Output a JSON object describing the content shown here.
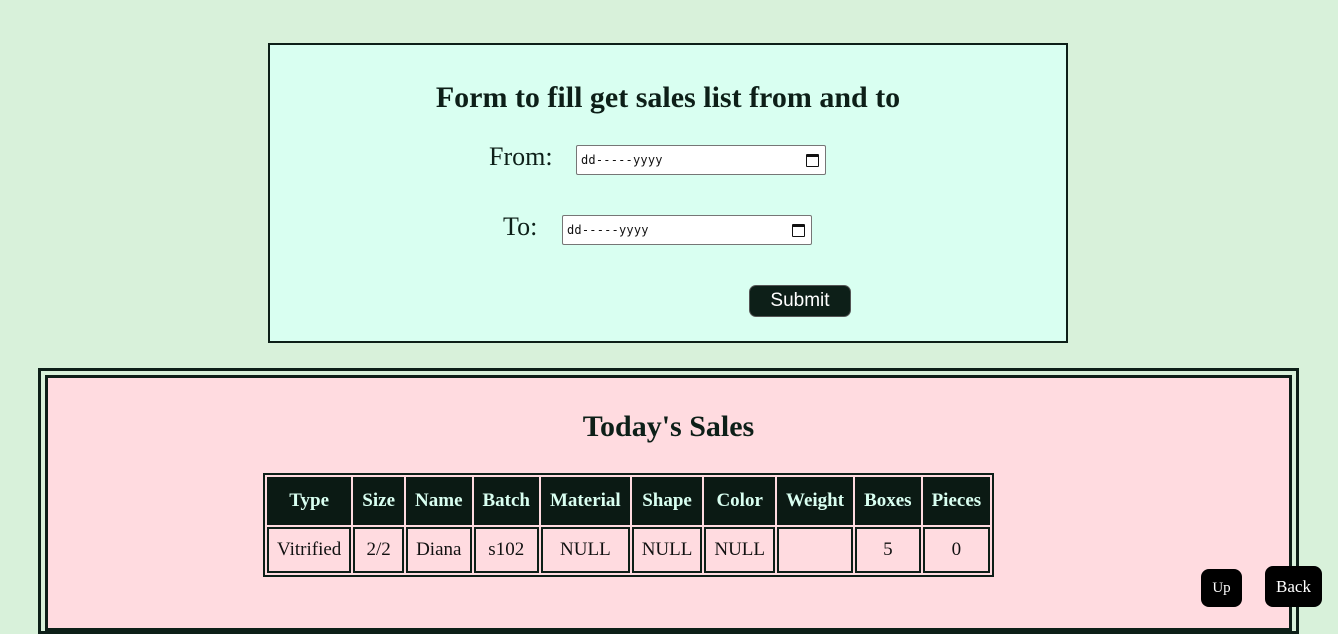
{
  "form": {
    "title": "Form to fill get sales list from and to",
    "from_label": "From:",
    "to_label": "To:",
    "from_placeholder": "dd-----yyyy",
    "to_placeholder": "dd-----yyyy",
    "submit_label": "Submit"
  },
  "sales": {
    "title": "Today's Sales",
    "columns": [
      "Type",
      "Size",
      "Name",
      "Batch",
      "Material",
      "Shape",
      "Color",
      "Weight",
      "Boxes",
      "Pieces"
    ],
    "rows": [
      [
        "Vitrified",
        "2/2",
        "Diana",
        "s102",
        "NULL",
        "NULL",
        "NULL",
        "",
        "5",
        "0"
      ]
    ]
  },
  "nav": {
    "up_label": "Up",
    "back_label": "Back"
  },
  "colors": {
    "page_bg": "#d8f1da",
    "form_bg": "#d9fff1",
    "sales_bg": "#ffdbe0",
    "header_bg": "#0b1a14"
  }
}
